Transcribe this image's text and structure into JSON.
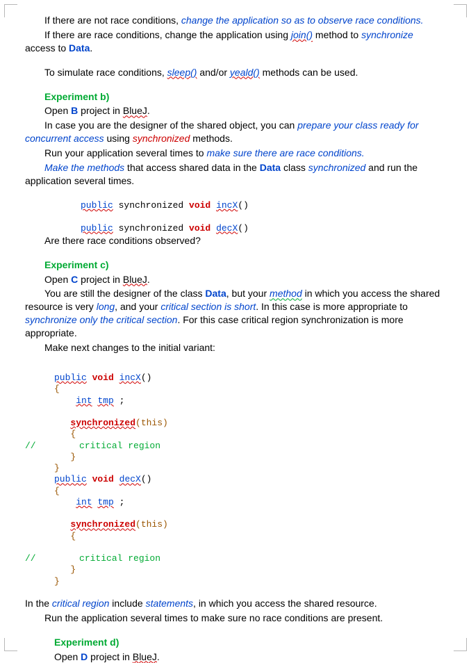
{
  "p1a": "If there are not race conditions, ",
  "p1b": "change the application so as to observe race conditions.",
  "p2a": "If there are race conditions, change the application using ",
  "p2b": "join()",
  "p2c": " method to ",
  "p2d": "synchronize",
  "p2e": " access to ",
  "p2f": "Data",
  "p2g": ".",
  "p3a": "To simulate race conditions, ",
  "p3b": "sleep()",
  "p3c": " and/or ",
  "p3d": "yeald()",
  "p3e": " methods can be used.",
  "hB": "Experiment b)",
  "b1a": "Open ",
  "b1b": "B",
  "b1c": " project in ",
  "b1d": "BlueJ",
  "b1e": ".",
  "b2a": "In case you are the designer of the shared object, you can ",
  "b2b": "prepare your class ready for concurrent access",
  "b2c": " using ",
  "b2d": "synchronized",
  "b2e": " methods.",
  "b3a": "Run your application several times to ",
  "b3b": "make sure there are race conditions.",
  "b4a": "Make the methods",
  "b4b": " that access shared data in the ",
  "b4c": "Data",
  "b4d": " class ",
  "b4e": "synchronized",
  "b4f": " and run the application several times.",
  "code1a": "public",
  "code1b": " synchronized ",
  "code1c": "void",
  "code1d": "incX",
  "code1e": "()",
  "code2d": "decX",
  "b5": "Are there race conditions observed?",
  "hC": "Experiment c)",
  "c1a": "Open ",
  "c1b": "C",
  "c1c": " project in ",
  "c1d": "BlueJ",
  "c1e": ".",
  "c2a": "You are still the designer of the class ",
  "c2b": "Data",
  "c2c": ", but your ",
  "c2d": "method",
  "c2e": " in which you access the shared resource is very ",
  "c2f": "long",
  "c2g": ", and your ",
  "c2h": "critical section is short",
  "c2i": ". In this case is more appropriate to ",
  "c2j": "synchronize only the critical section",
  "c2k": ". For this case critical region synchronization is more appropriate.",
  "c3": "Make next changes to the initial variant:",
  "code_c": {
    "kw_public": "public",
    "kw_void": "void",
    "incX": "incX",
    "decX": "decX",
    "par": "()",
    "ob": "{",
    "cb": "}",
    "kw_int": "int",
    "tmp": "tmp",
    "semi": " ;",
    "sync": "synchronized",
    "this": "(this)",
    "comment": "//        critical region"
  },
  "c4a": "In the ",
  "c4b": "critical region",
  "c4c": " include ",
  "c4d": "statements",
  "c4e": ", in which you access the shared resource.",
  "c5": "Run the application several times to make sure no race conditions are present.",
  "hD": "Experiment d)",
  "d1a": "Open ",
  "d1b": "D",
  "d1c": " project in ",
  "d1d": "BlueJ",
  "d1e": "."
}
